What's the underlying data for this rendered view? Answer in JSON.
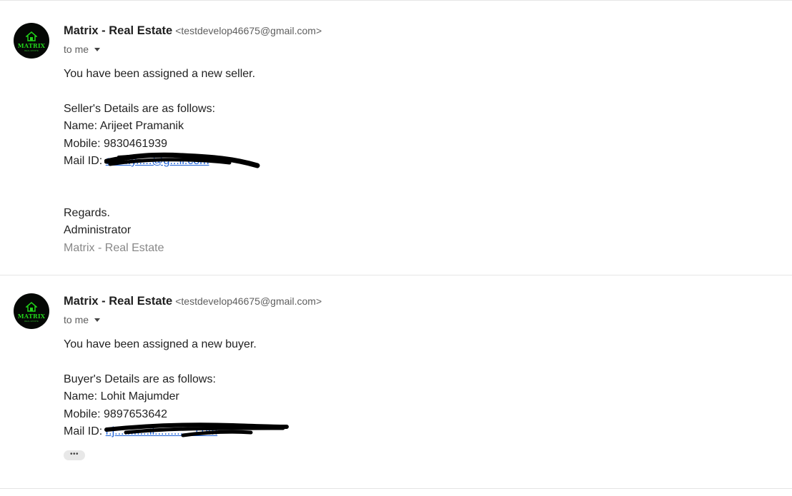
{
  "messages": [
    {
      "sender_name": "Matrix - Real Estate",
      "sender_email": "<testdevelop46675@gmail.com>",
      "recipient_label": "to me",
      "avatar_text": "MATRIX",
      "avatar_subtext": "REAL ESTATE",
      "body": {
        "intro": "You have been assigned a new seller.",
        "details_heading": "Seller's Details are as follows:",
        "name": "Name: Arijeet Pramanik",
        "mobile": "Mobile: 9830461939",
        "mail_label": "Mail ID:",
        "mail_link": "ar.....y.....@g...il.com",
        "regards": "Regards.",
        "signer": "Administrator",
        "signature_org": "Matrix - Real Estate"
      }
    },
    {
      "sender_name": "Matrix - Real Estate",
      "sender_email": "<testdevelop46675@gmail.com>",
      "recipient_label": "to me",
      "avatar_text": "MATRIX",
      "avatar_subtext": "REAL ESTATE",
      "body": {
        "intro": "You have been assigned a new buyer.",
        "details_heading": "Buyer's Details are as follows:",
        "name": "Name: Lohit Majumder",
        "mobile": "Mobile: 9897653642",
        "mail_label": "Mail ID:",
        "mail_link": "r.j...........il.............com"
      },
      "show_trimmed_content_label": "•••"
    }
  ],
  "colors": {
    "link": "#1a5fd6",
    "logo_green": "#22d11a",
    "avatar_bg": "#050805"
  },
  "icons": [
    "matrix-logo-icon",
    "chevron-down-icon",
    "more-icon"
  ]
}
